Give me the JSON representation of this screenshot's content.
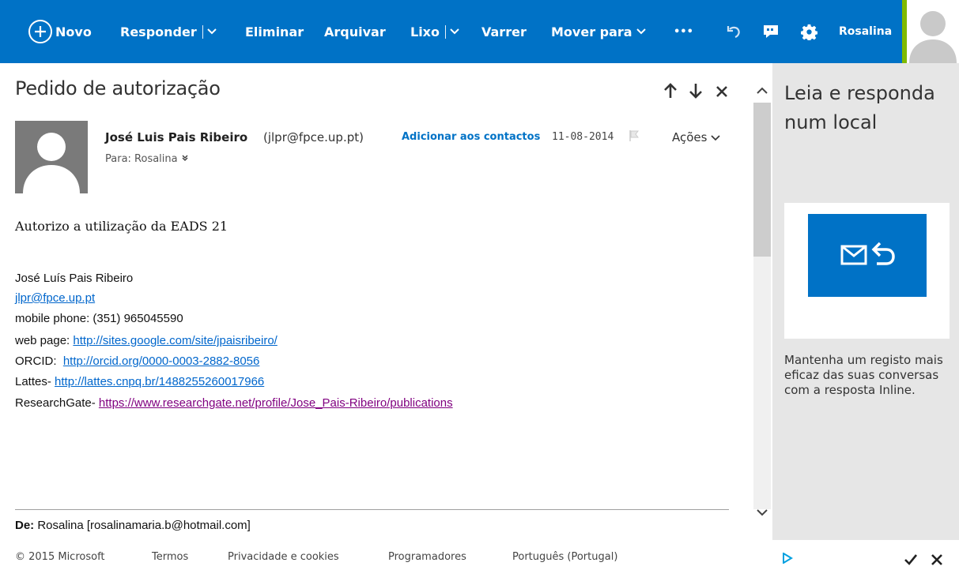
{
  "toolbar": {
    "new_label": "Novo",
    "reply_label": "Responder",
    "delete_label": "Eliminar",
    "archive_label": "Arquivar",
    "junk_label": "Lixo",
    "sweep_label": "Varrer",
    "move_label": "Mover para",
    "more_label": "•••",
    "user_name": "Rosalina"
  },
  "message": {
    "subject": "Pedido de autorização",
    "sender_name": "José Luis Pais Ribeiro",
    "sender_email": "(jlpr@fpce.up.pt)",
    "add_contact": "Adicionar aos contactos",
    "date": "11-08-2014",
    "actions_label": "Ações",
    "to_line": "Para: Rosalina",
    "body": "Autorizo a utilização da EADS 21",
    "signature": {
      "name": "José Luís Pais Ribeiro",
      "email": "jlpr@fpce.up.pt",
      "mobile": "mobile phone: (351) 965045590",
      "web_prefix": "web page: ",
      "web_url": "http://sites.google.com/site/jpaisribeiro/",
      "orcid_prefix": "ORCID:  ",
      "orcid_url": "http://orcid.org/0000-0003-2882-8056",
      "lattes_prefix": "Lattes- ",
      "lattes_url": "http://lattes.cnpq.br/1488255260017966",
      "rg_prefix": "ResearchGate- ",
      "rg_url": "https://www.researchgate.net/profile/Jose_Pais-Ribeiro/publications"
    },
    "quoted_from_label": "De:",
    "quoted_from_value": " Rosalina [rosalinamaria.b@hotmail.com]"
  },
  "promo": {
    "title": "Leia e responda num local",
    "text": "Mantenha um registo mais eficaz das suas conversas com a resposta Inline."
  },
  "footer": {
    "copyright": "© 2015 Microsoft",
    "terms": "Termos",
    "privacy": "Privacidade e cookies",
    "developers": "Programadores",
    "language": "Português (Portugal)"
  },
  "colors": {
    "topbar": "#0072c6",
    "accent": "#7fba00",
    "link": "#0066cc",
    "visited_link": "#800080"
  }
}
